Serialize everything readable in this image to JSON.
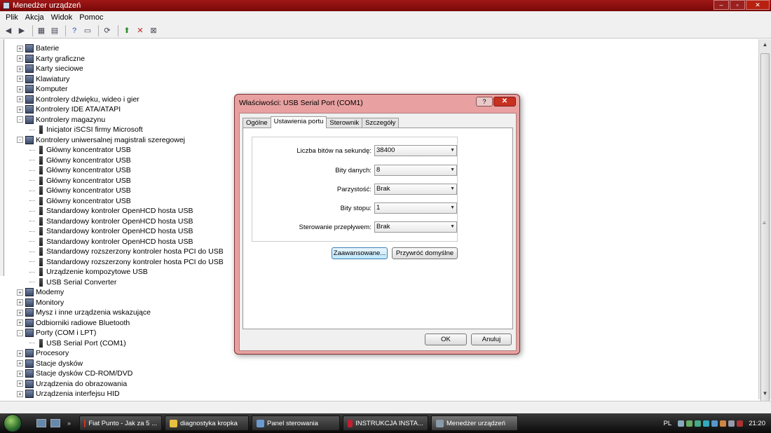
{
  "window": {
    "title": "Menedżer urządzeń",
    "buttons": {
      "minimize": "–",
      "maximize": "▫",
      "close": "✕"
    }
  },
  "menu": [
    "Plik",
    "Akcja",
    "Widok",
    "Pomoc"
  ],
  "toolbar": {
    "buttons": [
      "back-icon",
      "forward-icon",
      "console-tree-icon",
      "properties-icon",
      "help-icon",
      "view-icon",
      "scan-icon",
      "update-driver-icon",
      "disable-icon",
      "uninstall-icon"
    ]
  },
  "tree": [
    {
      "label": "Baterie",
      "level": 0,
      "exp": "+"
    },
    {
      "label": "Karty graficzne",
      "level": 0,
      "exp": "+"
    },
    {
      "label": "Karty sieciowe",
      "level": 0,
      "exp": "+"
    },
    {
      "label": "Klawiatury",
      "level": 0,
      "exp": "+"
    },
    {
      "label": "Komputer",
      "level": 0,
      "exp": "+"
    },
    {
      "label": "Kontrolery dźwięku, wideo i gier",
      "level": 0,
      "exp": "+"
    },
    {
      "label": "Kontrolery IDE ATA/ATAPI",
      "level": 0,
      "exp": "+"
    },
    {
      "label": "Kontrolery magazynu",
      "level": 0,
      "exp": "-"
    },
    {
      "label": "Inicjator iSCSI firmy Microsoft",
      "level": 1
    },
    {
      "label": "Kontrolery uniwersalnej magistrali szeregowej",
      "level": 0,
      "exp": "-"
    },
    {
      "label": "Główny koncentrator USB",
      "level": 1
    },
    {
      "label": "Główny koncentrator USB",
      "level": 1
    },
    {
      "label": "Główny koncentrator USB",
      "level": 1
    },
    {
      "label": "Główny koncentrator USB",
      "level": 1
    },
    {
      "label": "Główny koncentrator USB",
      "level": 1
    },
    {
      "label": "Główny koncentrator USB",
      "level": 1
    },
    {
      "label": "Standardowy kontroler OpenHCD hosta USB",
      "level": 1
    },
    {
      "label": "Standardowy kontroler OpenHCD hosta USB",
      "level": 1
    },
    {
      "label": "Standardowy kontroler OpenHCD hosta USB",
      "level": 1
    },
    {
      "label": "Standardowy kontroler OpenHCD hosta USB",
      "level": 1
    },
    {
      "label": "Standardowy rozszerzony kontroler hosta PCI do USB",
      "level": 1
    },
    {
      "label": "Standardowy rozszerzony kontroler hosta PCI do USB",
      "level": 1
    },
    {
      "label": "Urządzenie kompozytowe USB",
      "level": 1
    },
    {
      "label": "USB Serial Converter",
      "level": 1
    },
    {
      "label": "Modemy",
      "level": 0,
      "exp": "+"
    },
    {
      "label": "Monitory",
      "level": 0,
      "exp": "+"
    },
    {
      "label": "Mysz i inne urządzenia wskazujące",
      "level": 0,
      "exp": "+"
    },
    {
      "label": "Odbiorniki radiowe Bluetooth",
      "level": 0,
      "exp": "+"
    },
    {
      "label": "Porty (COM i LPT)",
      "level": 0,
      "exp": "-"
    },
    {
      "label": "USB Serial Port (COM1)",
      "level": 1
    },
    {
      "label": "Procesory",
      "level": 0,
      "exp": "+"
    },
    {
      "label": "Stacje dysków",
      "level": 0,
      "exp": "+"
    },
    {
      "label": "Stacje dysków CD-ROM/DVD",
      "level": 0,
      "exp": "+"
    },
    {
      "label": "Urządzenia do obrazowania",
      "level": 0,
      "exp": "+"
    },
    {
      "label": "Urządzenia interfejsu HID",
      "level": 0,
      "exp": "+"
    }
  ],
  "dialog": {
    "title": "Właściwości: USB Serial Port (COM1)",
    "help": "?",
    "close": "✕",
    "tabs": [
      "Ogólne",
      "Ustawienia portu",
      "Sterownik",
      "Szczegóły"
    ],
    "active_tab": 1,
    "fields": [
      {
        "label": "Liczba bitów na sekundę:",
        "value": "38400"
      },
      {
        "label": "Bity danych:",
        "value": "8"
      },
      {
        "label": "Parzystość:",
        "value": "Brak"
      },
      {
        "label": "Bity stopu:",
        "value": "1"
      },
      {
        "label": "Sterowanie przepływem:",
        "value": "Brak"
      }
    ],
    "advanced_label": "Zaawansowane...",
    "restore_label": "Przywróć domyślne",
    "ok_label": "OK",
    "cancel_label": "Anuluj"
  },
  "taskbar": {
    "tasks": [
      {
        "label": "Fiat Punto - Jak za 5 ...",
        "color": "#d03020"
      },
      {
        "label": "diagnostyka kropka",
        "color": "#e8c040"
      },
      {
        "label": "Panel sterowania",
        "color": "#6a9ad0"
      },
      {
        "label": "INSTRUKCJA INSTA...",
        "color": "#c02030"
      },
      {
        "label": "Menedżer urządzeń",
        "color": "#8a9aaa"
      }
    ],
    "active_task": 4,
    "language": "PL",
    "clock": "21:20"
  }
}
